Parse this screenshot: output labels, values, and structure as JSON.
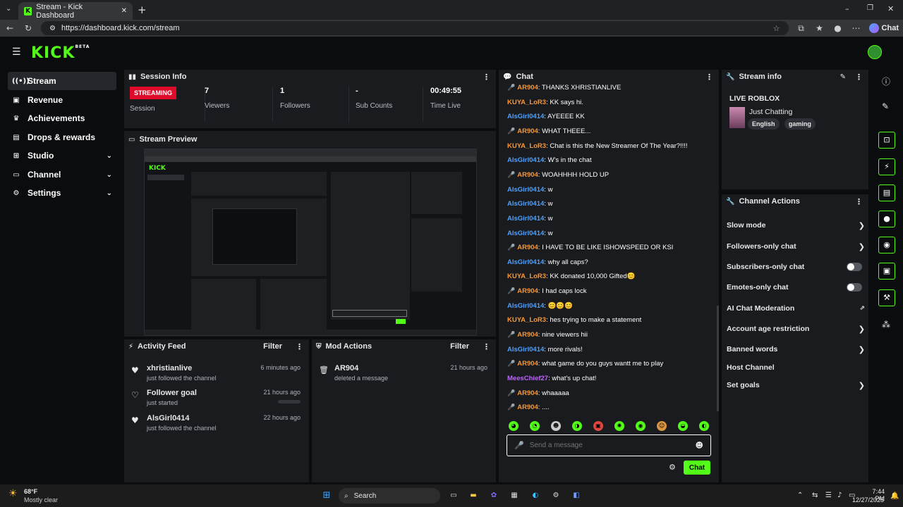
{
  "browser": {
    "tab_title": "Stream - Kick Dashboard",
    "url": "https://dashboard.kick.com/stream",
    "chat_button": "Chat"
  },
  "brand": {
    "logo": "KICK",
    "beta": "BETA",
    "accent": "#53fc18"
  },
  "sidebar": {
    "items": [
      {
        "label": "Stream",
        "icon": "broadcast-icon",
        "active": true
      },
      {
        "label": "Revenue",
        "icon": "wallet-icon"
      },
      {
        "label": "Achievements",
        "icon": "trophy-icon"
      },
      {
        "label": "Drops & rewards",
        "icon": "gift-icon"
      },
      {
        "label": "Studio",
        "icon": "studio-icon"
      },
      {
        "label": "Channel",
        "icon": "channel-icon"
      },
      {
        "label": "Settings",
        "icon": "gear-icon"
      }
    ]
  },
  "session": {
    "title": "Session Info",
    "status": "STREAMING",
    "session_label": "Session",
    "stats": [
      {
        "value": "7",
        "label": "Viewers"
      },
      {
        "value": "1",
        "label": "Followers"
      },
      {
        "value": "-",
        "label": "Sub Counts"
      },
      {
        "value": "00:49:55",
        "label": "Time Live"
      }
    ]
  },
  "preview": {
    "title": "Stream Preview"
  },
  "activity": {
    "title": "Activity Feed",
    "filter": "Filter",
    "items": [
      {
        "name": "xhristianlive",
        "sub": "just followed the channel",
        "time": "6 minutes ago"
      },
      {
        "name": "Follower goal",
        "sub": "just started",
        "time": "21 hours ago"
      },
      {
        "name": "AlsGirl0414",
        "sub": "just followed the channel",
        "time": "22 hours ago"
      }
    ]
  },
  "mod": {
    "title": "Mod Actions",
    "filter": "Filter",
    "items": [
      {
        "name": "AR904",
        "sub": "deleted a message",
        "time": "21 hours ago"
      }
    ]
  },
  "chat": {
    "title": "Chat",
    "messages": [
      {
        "user": "AR904",
        "mic": true,
        "color": "orange",
        "text": "THANKS XHRISTIANLIVE"
      },
      {
        "user": "KUYA_LoR3",
        "mic": false,
        "color": "orange",
        "text": "KK says hi."
      },
      {
        "user": "AlsGirl0414",
        "mic": false,
        "color": "blue",
        "text": "AYEEEE KK"
      },
      {
        "user": "AR904",
        "mic": true,
        "color": "orange",
        "text": "WHAT THEEE..."
      },
      {
        "user": "KUYA_LoR3",
        "mic": false,
        "color": "orange",
        "text": "Chat is this the New Streamer Of The Year?!!!!"
      },
      {
        "user": "AlsGirl0414",
        "mic": false,
        "color": "blue",
        "text": "W's in the chat"
      },
      {
        "user": "AR904",
        "mic": true,
        "color": "orange",
        "text": "WOAHHHH HOLD UP"
      },
      {
        "user": "AlsGirl0414",
        "mic": false,
        "color": "blue",
        "text": "w"
      },
      {
        "user": "AlsGirl0414",
        "mic": false,
        "color": "blue",
        "text": "w"
      },
      {
        "user": "AlsGirl0414",
        "mic": false,
        "color": "blue",
        "text": "w"
      },
      {
        "user": "AlsGirl0414",
        "mic": false,
        "color": "blue",
        "text": "w"
      },
      {
        "user": "AR904",
        "mic": true,
        "color": "orange",
        "text": "I HAVE TO BE LIKE ISHOWSPEED OR KSI"
      },
      {
        "user": "AlsGirl0414",
        "mic": false,
        "color": "blue",
        "text": "why all caps?"
      },
      {
        "user": "KUYA_LoR3",
        "mic": false,
        "color": "orange",
        "text": "KK donated 10,000 Gifted😊"
      },
      {
        "user": "AR904",
        "mic": true,
        "color": "orange",
        "text": "I had caps lock"
      },
      {
        "user": "AlsGirl0414",
        "mic": false,
        "color": "blue",
        "text": "😊😊😊"
      },
      {
        "user": "KUYA_LoR3",
        "mic": false,
        "color": "orange",
        "text": "hes trying to make a statement"
      },
      {
        "user": "AR904",
        "mic": true,
        "color": "orange",
        "text": "nine viewers hii"
      },
      {
        "user": "AlsGirl0414",
        "mic": false,
        "color": "blue",
        "text": "more rivals!"
      },
      {
        "user": "AR904",
        "mic": true,
        "color": "orange",
        "text": "what game do you guys wantt me to play"
      },
      {
        "user": "MeesChief27",
        "mic": false,
        "color": "purple",
        "text": "what's up chat!"
      },
      {
        "user": "AR904",
        "mic": true,
        "color": "orange",
        "text": "whaaaaa"
      },
      {
        "user": "AR904",
        "mic": true,
        "color": "orange",
        "text": "...."
      }
    ],
    "placeholder": "Send a message",
    "send_button": "Chat"
  },
  "stream_info": {
    "title": "Stream info",
    "stream_title": "LIVE ROBLOX",
    "category": "Just Chatting",
    "tags": [
      "English",
      "gaming"
    ]
  },
  "channel_actions": {
    "title": "Channel Actions",
    "items": [
      {
        "label": "Slow mode",
        "control": "arrow"
      },
      {
        "label": "Followers-only chat",
        "control": "arrow"
      },
      {
        "label": "Subscribers-only chat",
        "control": "toggle"
      },
      {
        "label": "Emotes-only chat",
        "control": "toggle"
      },
      {
        "label": "AI Chat Moderation",
        "control": "external"
      },
      {
        "label": "Account age restriction",
        "control": "arrow"
      },
      {
        "label": "Banned words",
        "control": "arrow"
      },
      {
        "label": "Host Channel",
        "control": "none"
      },
      {
        "label": "Set goals",
        "control": "arrow"
      }
    ]
  },
  "taskbar": {
    "weather_temp": "68°F",
    "weather_desc": "Mostly clear",
    "search": "Search",
    "time": "7:44 PM",
    "date": "12/27/2025"
  }
}
